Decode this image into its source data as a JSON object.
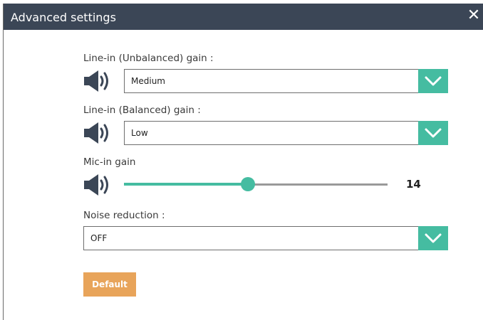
{
  "dialog": {
    "title": "Advanced settings",
    "close_glyph": "✕"
  },
  "settings": {
    "line_in_unbalanced": {
      "label": "Line-in (Unbalanced) gain :",
      "value": "Medium",
      "icon": "speaker-icon"
    },
    "line_in_balanced": {
      "label": "Line-in (Balanced) gain :",
      "value": "Low",
      "icon": "speaker-icon"
    },
    "mic_in": {
      "label": "Mic-in gain",
      "value": "14",
      "fraction": 0.47,
      "icon": "speaker-icon"
    },
    "noise_reduction": {
      "label": "Noise reduction :",
      "value": "OFF"
    }
  },
  "buttons": {
    "default_label": "Default"
  },
  "colors": {
    "titlebar": "#3b4656",
    "accent": "#45bca1",
    "button": "#e8a45a"
  }
}
